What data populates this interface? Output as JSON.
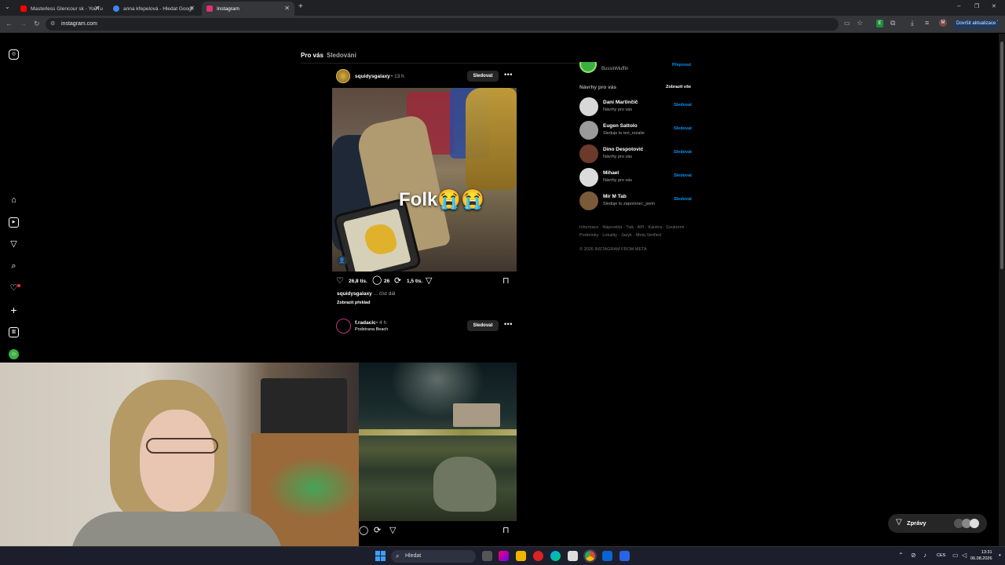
{
  "browser": {
    "tabs": [
      {
        "title": "Masterless Glencour sk - YouTu",
        "favicon_color": "#ff0000"
      },
      {
        "title": "anna křepelová - Hledat Googl",
        "favicon_color": "#4285f4"
      },
      {
        "title": "Instagram",
        "favicon_color": "#e1306c"
      }
    ],
    "url": "instagram.com",
    "update_label": "Dovršit aktualizace",
    "profile_initial": "M",
    "extension_badge": "E"
  },
  "feed": {
    "tabs": [
      "Pro vás",
      "Sledování"
    ],
    "posts": [
      {
        "username": "squidysgalaxy",
        "time": "• 13 h",
        "follow_label": "Sledovat",
        "overlay_text": "Folk😭😭",
        "likes": "26,8 tis.",
        "comments": "26",
        "reposts": "1,5 tis.",
        "caption_user": "squidysgalaxy",
        "caption_more": "... číst dál",
        "translate_label": "Zobrazit překlad"
      },
      {
        "username": "f.radacic",
        "time": "• 4 h",
        "location": "Podstrana Beach",
        "follow_label": "Sledovat"
      }
    ]
  },
  "sidebar_right": {
    "current_user": "BussinMuffin",
    "switch_label": "Přepnout",
    "suggestions_title": "Návrhy pro vás",
    "show_all": "Zobrazit vše",
    "suggestions": [
      {
        "name": "Dani Martinčič",
        "sub": "Návrhy pro vás",
        "action": "Sledovat",
        "avatar_color": "#d8d8d8"
      },
      {
        "name": "Eugen Sattolo",
        "sub": "Sleduje to teri_rozalie",
        "action": "Sledovat",
        "avatar_color": "#9a9a9a"
      },
      {
        "name": "Dino Despotović",
        "sub": "Návrhy pro vás",
        "action": "Sledovat",
        "avatar_color": "#6b3a2a"
      },
      {
        "name": "Mihael",
        "sub": "Návrhy pro vás",
        "action": "Sledovat",
        "avatar_color": "#dbdbdb"
      },
      {
        "name": "Mir M Tab",
        "sub": "Sleduje to zapomnel._jsem",
        "action": "Sledovat",
        "avatar_color": "#7a5a3a"
      }
    ],
    "footer_lines": [
      "Informace · Nápověda · Tisk · API · Kariéra · Soukromí ·",
      "Podmínky · Lokality · Jazyk · Meta Verified"
    ],
    "copyright": "© 2026 INSTAGRAM FROM META"
  },
  "messages": {
    "label": "Zprávy"
  },
  "taskbar": {
    "search_placeholder": "Hledat",
    "lang": "CES",
    "time": "13:31",
    "date": "06.08.2026"
  },
  "colors": {
    "accent": "#0095f6",
    "background": "#000000",
    "follow_bg": "#262626"
  }
}
